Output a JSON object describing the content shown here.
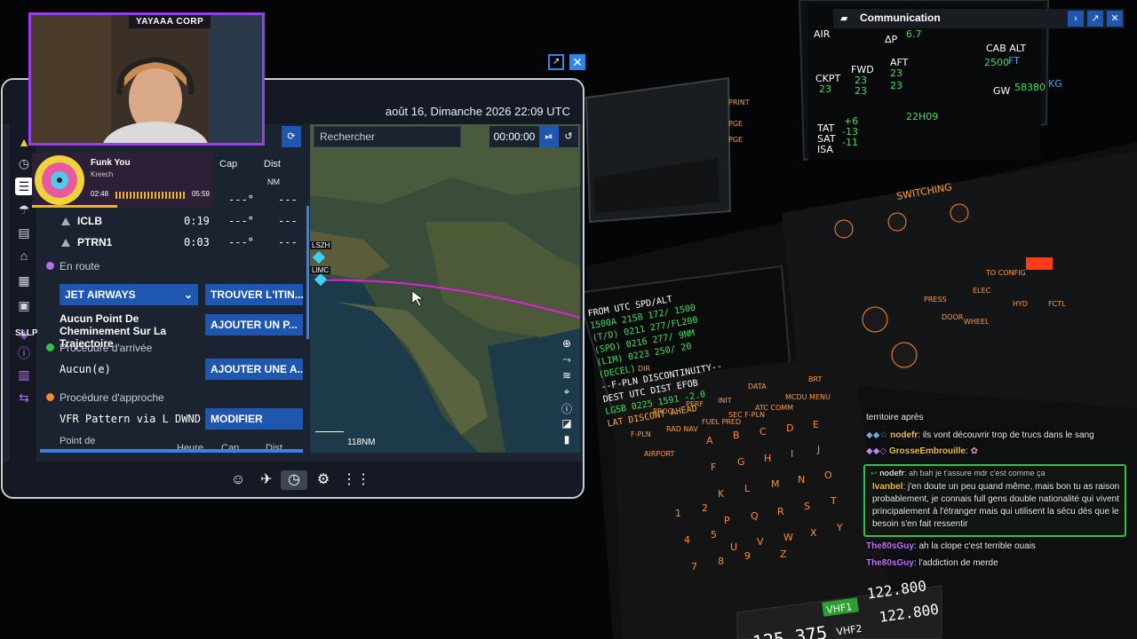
{
  "webcam": {
    "title": "YAYAAA CORP"
  },
  "music": {
    "title": "Funk You",
    "artist": "Kreech",
    "current": "02:48",
    "total": "05:59",
    "progress": 0.47
  },
  "tablet": {
    "datetime": "août 16, Dimanche 2026 22:09 UTC",
    "sidebar_label": "SLLP",
    "columns": {
      "cap": "Cap",
      "dist": "Dist",
      "dist_unit": "NM"
    },
    "first_row": {
      "cap": "---°",
      "dist": "---"
    },
    "waypoints": [
      {
        "ident": "ICLB",
        "time": "0:19",
        "cap": "---°",
        "dist": "---"
      },
      {
        "ident": "PTRN1",
        "time": "0:03",
        "cap": "---°",
        "dist": "---"
      }
    ],
    "en_route": {
      "label": "En route",
      "airway": "JET AIRWAYS",
      "find_route": "TROUVER L'ITIN...",
      "no_waypoint": "Aucun Point De Cheminement Sur La Trajectoire",
      "add_waypoint": "AJOUTER UN P..."
    },
    "arrival": {
      "label": "Procédure d'arrivée",
      "value": "Aucun(e)",
      "add": "AJOUTER UNE A..."
    },
    "approach": {
      "label": "Procédure d'approche",
      "value": "VFR Pattern via L DWND",
      "modify": "MODIFIER"
    },
    "footer_cols": {
      "point": "Point de",
      "heure": "Heure",
      "cap": "Cap",
      "dist": "Dist"
    },
    "search_placeholder": "Rechercher",
    "timer": "00:00:00",
    "map": {
      "label_lszh": "LSZH",
      "label_limc": "LIMC",
      "scale": "118NM"
    }
  },
  "communication": {
    "title": "Communication"
  },
  "chat": [
    {
      "user": "",
      "text": "territoire après",
      "user_color": "#ffffff"
    },
    {
      "user": "nodefr",
      "text": "ils vont découvrir trop de trucs dans le sang",
      "user_color": "#f0c030"
    },
    {
      "user": "GrosseEmbrouille",
      "text": "",
      "user_color": "#f0c030"
    },
    {
      "user": "nodefr",
      "text": "ah bah je t'assure mdr c'est comme ça",
      "user_color": "#ffffff"
    },
    {
      "user": "Ivanbel",
      "text": "j'en doute un peu quand même, mais bon tu as raison probablement, je connais full gens double nationalité qui vivent principalement à l'étranger mais qui utilisent la sécu dès que le besoin s'en fait ressentir",
      "user_color": "#f0c030"
    },
    {
      "user": "The80sGuy",
      "text": "ah la clope c'est terrible ouais",
      "user_color": "#c070ff"
    },
    {
      "user": "The80sGuy",
      "text": "l'addiction de merde",
      "user_color": "#c070ff"
    }
  ],
  "cockpit": {
    "mcdu_lines": [
      "FROM    UTC  SPD/ALT",
      "1500A   2158  172/ 1500",
      "(T/D)   0211  277/FL200",
      "(SPD)   0216  277/ 9NM",
      "(LIM)   0223  250/ 20",
      "(DECEL)",
      "--F-PLN DISCONTINUITY--",
      "DEST    UTC  DIST  EFOB",
      "LGSB    0225  1591  -2.0",
      "LAT DISCONT AHEAD"
    ],
    "ecam": {
      "air": "AIR",
      "dp": "ΔP",
      "dp_val": "6.7",
      "cab_alt": "CAB ALT",
      "cab_alt_val": "2500",
      "ft": "FT",
      "ckpt": "CKPT",
      "ckpt_val": "23",
      "fwd": "FWD",
      "fwd_val": "23",
      "fwd_val2": "23",
      "aft": "AFT",
      "aft_val": "23",
      "aft_val2": "23",
      "tat": "TAT",
      "tat_val": "+6",
      "sat": "SAT",
      "sat_val": "-13",
      "isa": "ISA",
      "isa_val": "-11",
      "time": "22H09",
      "gw": "GW",
      "gw_val": "58380",
      "kg": "KG"
    },
    "radio": {
      "active": "125.375",
      "vhf1": "VHF1",
      "vhf2": "VHF2",
      "standby1": "122.800",
      "standby2": "122.800"
    },
    "keys": [
      "DIR",
      "PROG",
      "PERF",
      "INIT",
      "DATA",
      "F-PLN",
      "RAD NAV",
      "FUEL PRED",
      "SEC F-PLN",
      "ATC COMM",
      "MCDU MENU",
      "AIRPORT"
    ],
    "switching": "SWITCHING"
  }
}
